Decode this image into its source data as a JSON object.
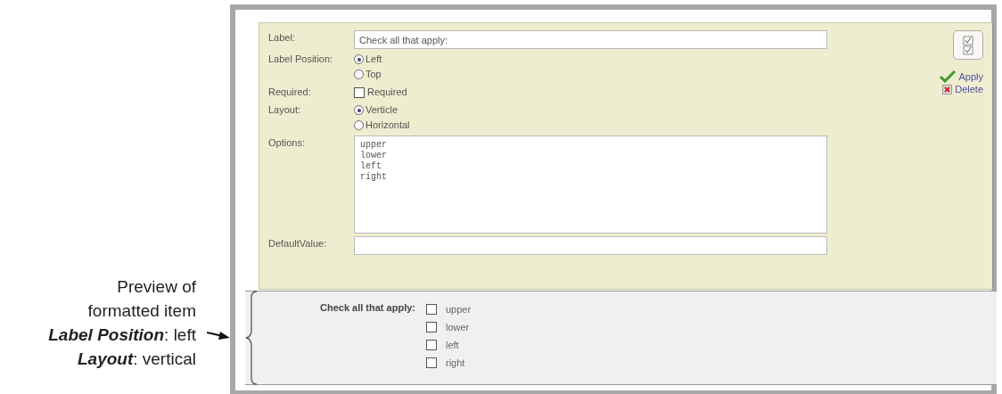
{
  "annotation": {
    "lines": [
      "Preview of",
      "formatted item",
      "**Label Position**: left",
      "**Layout**: vertical"
    ]
  },
  "editor": {
    "fields": [
      {
        "kind": "text",
        "label": "Label:",
        "value": "Check all that apply:"
      },
      {
        "kind": "radio",
        "label": "Label Position:",
        "options": [
          {
            "label": "Left",
            "selected": true
          },
          {
            "label": "Top",
            "selected": false
          }
        ]
      },
      {
        "kind": "checkbox",
        "label": "Required:",
        "option": {
          "label": "Required",
          "checked": false
        }
      },
      {
        "kind": "radio",
        "label": "Layout:",
        "options": [
          {
            "label": "Verticle",
            "selected": true
          },
          {
            "label": "Horizontal",
            "selected": false
          }
        ]
      },
      {
        "kind": "textarea",
        "label": "Options:",
        "value": "upper\nlower\nleft\nright"
      },
      {
        "kind": "text",
        "label": "DefaultValue:"
      }
    ],
    "actions": [
      {
        "kind": "apply",
        "label": "Apply"
      },
      {
        "kind": "delete",
        "label": "Delete"
      }
    ]
  },
  "preview": {
    "label": "Check all that apply:",
    "options": [
      {
        "label": "upper",
        "checked": false
      },
      {
        "label": "lower",
        "checked": false
      },
      {
        "label": "left",
        "checked": false
      },
      {
        "label": "right",
        "checked": false
      }
    ]
  }
}
